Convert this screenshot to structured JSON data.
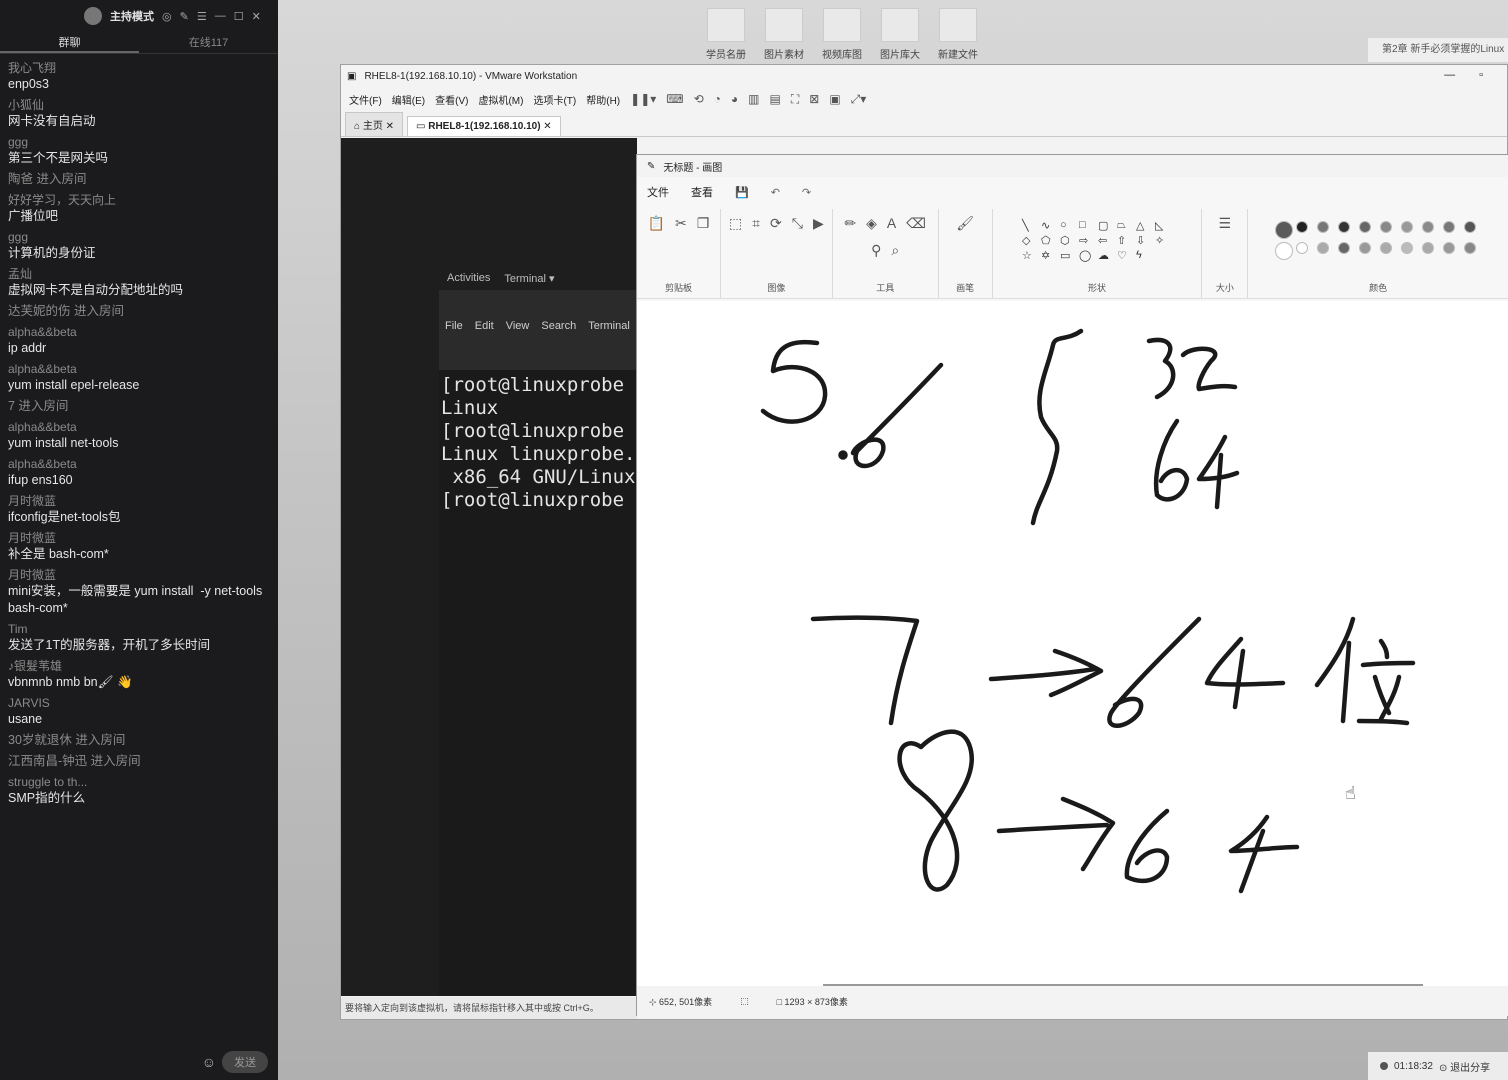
{
  "chat": {
    "mode_label": "主持模式",
    "tabs": [
      "群聊",
      "在线117"
    ],
    "messages": [
      {
        "user": "我心飞翔",
        "text": "enp0s3"
      },
      {
        "user": "小狐仙",
        "text": "网卡没有自启动"
      },
      {
        "user": "ggg",
        "text": "第三个不是网关吗"
      },
      {
        "user": "",
        "text": "陶爸 进入房间",
        "join": true
      },
      {
        "user": "好好学习，天天向上",
        "text": "广播位吧"
      },
      {
        "user": "ggg",
        "text": "计算机的身份证"
      },
      {
        "user": "孟灿",
        "text": "虚拟网卡不是自动分配地址的吗"
      },
      {
        "user": "",
        "text": "达芙妮的伤 进入房间",
        "join": true
      },
      {
        "user": "alpha&&beta",
        "text": "ip addr"
      },
      {
        "user": "alpha&&beta",
        "text": "yum install epel-release"
      },
      {
        "user": "",
        "text": "7 进入房间",
        "join": true
      },
      {
        "user": "alpha&&beta",
        "text": "yum install net-tools"
      },
      {
        "user": "alpha&&beta",
        "text": "ifup ens160"
      },
      {
        "user": "月时微蓝",
        "text": "ifconfig是net-tools包"
      },
      {
        "user": "月时微蓝",
        "text": "补全是 bash-com*"
      },
      {
        "user": "月时微蓝",
        "text": "mini安装，一般需要是 yum install  -y net-tools bash-com*"
      },
      {
        "user": "Tim",
        "text": "发送了1T的服务器，开机了多长时间"
      },
      {
        "user": "♪银髮苇雄",
        "text": "vbnmnb nmb bn🖌 👋"
      },
      {
        "user": "JARVIS",
        "text": "usane"
      },
      {
        "user": "",
        "text": "30岁就退休 进入房间",
        "join": true
      },
      {
        "user": "",
        "text": "江西南昌-钟迅 进入房间",
        "join": true
      },
      {
        "user": "struggle to th...",
        "text": "SMP指的什么"
      }
    ],
    "send_label": "发送"
  },
  "desktop": {
    "icons": [
      "学员名册",
      "图片素材库",
      "视频库图片",
      "图片库大全",
      "新建文件"
    ],
    "notification": "第2章 新手必须掌握的Linux"
  },
  "vmware": {
    "title": "RHEL8-1(192.168.10.10) - VMware Workstation",
    "menu": [
      "文件(F)",
      "编辑(E)",
      "查看(V)",
      "虚拟机(M)",
      "选项卡(T)",
      "帮助(H)"
    ],
    "tabs": [
      "主页",
      "RHEL8-1(192.168.10.10)"
    ],
    "gnome": {
      "activities": "Activities",
      "terminal": "Terminal ▾"
    },
    "terminal_menu": [
      "File",
      "Edit",
      "View",
      "Search",
      "Terminal"
    ],
    "terminal_lines": [
      "[root@linuxprobe",
      "Linux",
      "[root@linuxprobe",
      "Linux linuxprobe.",
      " x86_64 GNU/Linux",
      "[root@linuxprobe"
    ],
    "status": "要将输入定向到该虚拟机，请将鼠标指针移入其中或按 Ctrl+G。"
  },
  "paint": {
    "title": "无标题 - 画图",
    "menu": [
      "文件",
      "查看"
    ],
    "groups": [
      "剪贴板",
      "图像",
      "工具",
      "画笔",
      "形状",
      "大小",
      "颜色"
    ],
    "cursor_pos": "652, 501像素",
    "canvas_size": "1293 × 873像素",
    "handwriting": [
      "5.6",
      "{",
      "32",
      "64",
      "7",
      "→",
      "64位",
      "8",
      "→",
      "64"
    ]
  },
  "recording": {
    "time": "01:18:32",
    "exit_label": "退出分享"
  }
}
